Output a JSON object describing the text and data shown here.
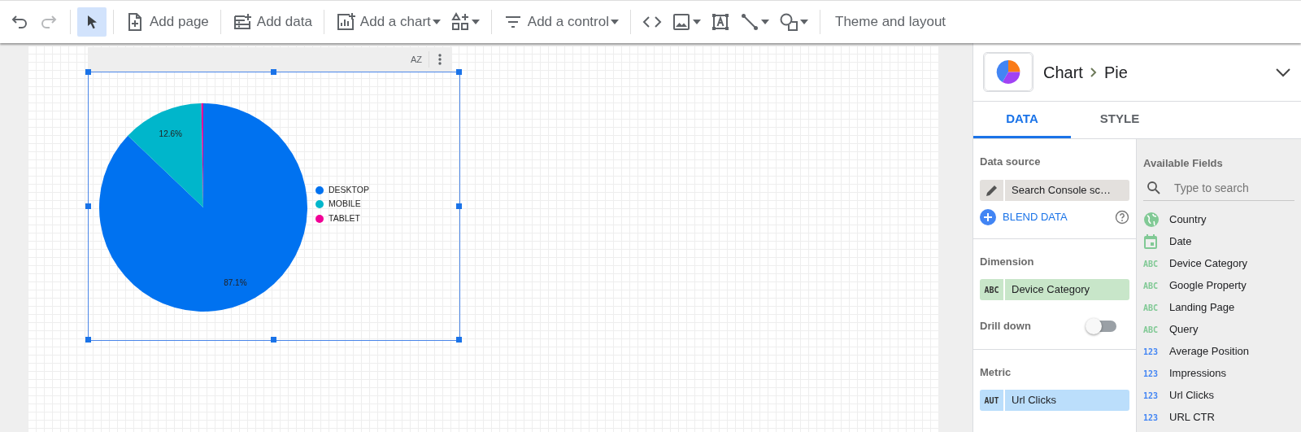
{
  "toolbar": {
    "groups": [
      [
        {
          "dropdown": false,
          "selected": false,
          "disabled": false
        },
        {
          "dropdown": false,
          "selected": false,
          "disabled": true
        }
      ],
      [
        {
          "dropdown": false,
          "selected": true,
          "disabled": false
        }
      ],
      [
        {
          "label": "Add page",
          "dropdown": false,
          "selected": false,
          "disabled": false
        }
      ],
      [
        {
          "label": "Add data",
          "dropdown": false,
          "selected": false,
          "disabled": false
        }
      ],
      [
        {
          "label": "Add a chart",
          "dropdown": true,
          "selected": false,
          "disabled": false
        },
        {
          "dropdown": true,
          "selected": false,
          "disabled": false
        }
      ],
      [
        {
          "label": "Add a control",
          "dropdown": true,
          "selected": false,
          "disabled": false
        }
      ],
      [
        {
          "dropdown": false,
          "selected": false,
          "disabled": false
        },
        {
          "dropdown": true,
          "selected": false,
          "disabled": false
        },
        {
          "dropdown": false,
          "selected": false,
          "disabled": false
        },
        {
          "dropdown": true,
          "selected": false,
          "disabled": false
        },
        {
          "dropdown": true,
          "selected": false,
          "disabled": false
        }
      ],
      [
        {
          "label": "Theme and layout",
          "dropdown": false,
          "selected": false,
          "disabled": false
        }
      ]
    ]
  },
  "chart": {
    "sort_label": "AZ",
    "selected": true,
    "chart_data": {
      "type": "pie",
      "categories": [
        "DESKTOP",
        "MOBILE",
        "TABLET"
      ],
      "series": [
        {
          "values": [
            87.1,
            12.6,
            0.3
          ]
        }
      ],
      "value_labels": [
        "87.1%",
        "12.6%",
        null
      ],
      "legend": true
    },
    "slices": [
      {
        "color": "#0072f0"
      },
      {
        "color": "#00b6cb"
      },
      {
        "color": "#f10096"
      }
    ]
  },
  "panel": {
    "category": "Chart",
    "type": "Pie",
    "tabs": [
      {
        "label": "DATA",
        "selected": true
      },
      {
        "label": "STYLE",
        "selected": false
      }
    ],
    "data_source": {
      "heading": "Data source",
      "name": "Search Console sc…",
      "blend_label": "BLEND DATA"
    },
    "dimension": {
      "heading": "Dimension",
      "tag": "ABC",
      "field": "Device Category"
    },
    "drill_down": {
      "label": "Drill down",
      "on": false
    },
    "metric": {
      "heading": "Metric",
      "tag": "AUT",
      "field": "Url Clicks"
    },
    "available_fields": {
      "heading": "Available Fields",
      "search_placeholder": "Type to search",
      "fields": [
        {
          "kind": "geo",
          "name": "Country"
        },
        {
          "kind": "date",
          "name": "Date"
        },
        {
          "kind": "text",
          "tag": "ABC",
          "name": "Device Category"
        },
        {
          "kind": "text",
          "tag": "ABC",
          "name": "Google Property"
        },
        {
          "kind": "text",
          "tag": "ABC",
          "name": "Landing Page"
        },
        {
          "kind": "text",
          "tag": "ABC",
          "name": "Query"
        },
        {
          "kind": "number",
          "tag": "123",
          "name": "Average Position"
        },
        {
          "kind": "number",
          "tag": "123",
          "name": "Impressions"
        },
        {
          "kind": "number",
          "tag": "123",
          "name": "Url Clicks"
        },
        {
          "kind": "number",
          "tag": "123",
          "name": "URL CTR"
        }
      ]
    }
  }
}
